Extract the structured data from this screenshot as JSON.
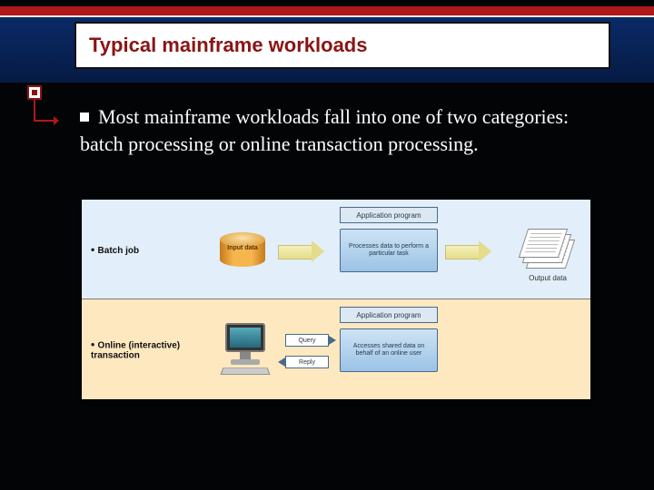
{
  "slide": {
    "title": "Typical mainframe workloads",
    "body_text": "Most mainframe workloads fall into one of two categories: batch processing or online transaction processing."
  },
  "diagram": {
    "row1": {
      "label": "Batch job",
      "input_label": "Input data",
      "app_title": "Application program",
      "app_desc": "Processes data to perform a particular task",
      "output_label": "Output data"
    },
    "row2": {
      "label": "Online (interactive) transaction",
      "query_label": "Query",
      "reply_label": "Reply",
      "app_title": "Application program",
      "app_desc": "Accesses shared data on behalf of an online user"
    }
  }
}
